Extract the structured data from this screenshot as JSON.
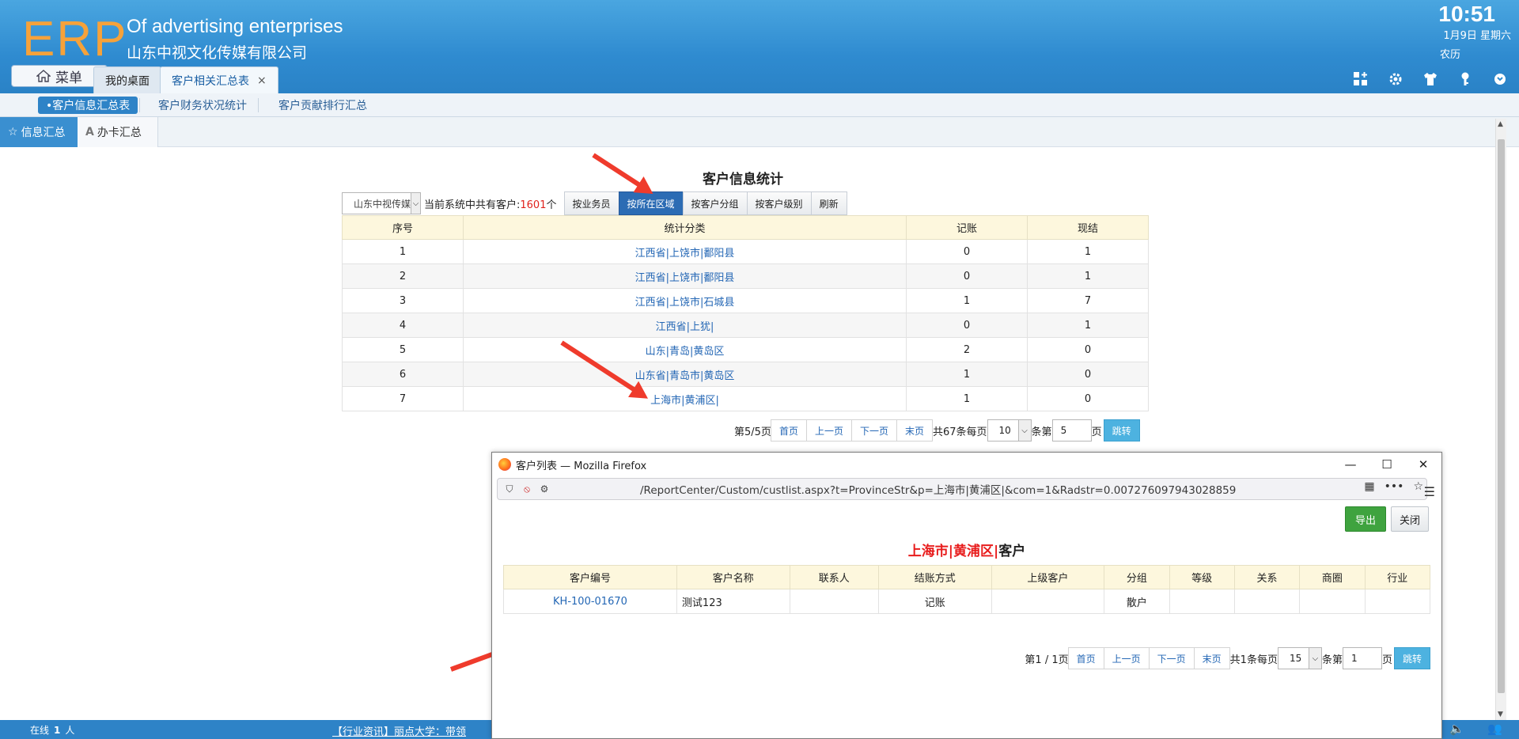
{
  "header": {
    "logo": "ERP",
    "title": "Of advertising enterprises",
    "subtitle": "山东中视文化传媒有限公司",
    "time": "10:51",
    "date": "1月9日 星期六",
    "lunar": "农历",
    "menu_label": "菜单",
    "tabs": [
      {
        "label": "我的桌面"
      },
      {
        "label": "客户相关汇总表",
        "close": "×"
      }
    ]
  },
  "subnav": {
    "items": [
      {
        "label": "•客户信息汇总表"
      },
      {
        "label": "客户财务状况统计"
      },
      {
        "label": "客户贡献排行汇总"
      }
    ]
  },
  "sidetabs": {
    "items": [
      {
        "label": "信息汇总",
        "icon": "star-icon"
      },
      {
        "label": "办卡汇总",
        "icon": "font-a-icon",
        "glyph": "A"
      }
    ]
  },
  "main": {
    "title": "客户信息统计",
    "company_select": "山东中视传媒",
    "count_prefix": "当前系统中共有客户:",
    "count_value": "1601",
    "count_suffix": "个",
    "buttons": [
      {
        "label": "按业务员"
      },
      {
        "label": "按所在区域"
      },
      {
        "label": "按客户分组"
      },
      {
        "label": "按客户级别"
      },
      {
        "label": "刷新"
      }
    ],
    "columns": [
      "序号",
      "统计分类",
      "记账",
      "现结"
    ],
    "rows": [
      {
        "no": "1",
        "category": "江西省|上饶市|鄱阳县",
        "credit": "0",
        "cash": "1"
      },
      {
        "no": "2",
        "category": "江西省|上饶市|鄱阳县",
        "credit": "0",
        "cash": "1"
      },
      {
        "no": "3",
        "category": "江西省|上饶市|石城县",
        "credit": "1",
        "cash": "7"
      },
      {
        "no": "4",
        "category": "江西省|上犹|",
        "credit": "0",
        "cash": "1"
      },
      {
        "no": "5",
        "category": "山东|青岛|黄岛区",
        "credit": "2",
        "cash": "0"
      },
      {
        "no": "6",
        "category": "山东省|青岛市|黄岛区",
        "credit": "1",
        "cash": "0"
      },
      {
        "no": "7",
        "category": "上海市|黄浦区|",
        "credit": "1",
        "cash": "0"
      }
    ],
    "pager": {
      "page_info": "第5/5页",
      "first": "首页",
      "prev": "上一页",
      "next": "下一页",
      "last": "末页",
      "total_text": "共67条每页",
      "page_size": "10",
      "goto_prefix": "条第",
      "goto_value": "5",
      "goto_suffix": "页",
      "go": "跳转"
    }
  },
  "popup": {
    "window_title": "客户列表 — Mozilla Firefox",
    "url": "/ReportCenter/Custom/custlist.aspx?t=ProvinceStr&p=上海市|黄浦区|&com=1&Radstr=0.007276097943028859",
    "export": "导出",
    "close": "关闭",
    "title_red": "上海市|黄浦区|",
    "title_suffix": "客户",
    "columns": [
      "客户编号",
      "客户名称",
      "联系人",
      "结账方式",
      "上级客户",
      "分组",
      "等级",
      "关系",
      "商圈",
      "行业"
    ],
    "rows": [
      {
        "code": "KH-100-01670",
        "name": "测试123",
        "contact": "",
        "pay": "记账",
        "parent": "",
        "group": "散户",
        "level": "",
        "relation": "",
        "area": "",
        "industry": ""
      }
    ],
    "pager": {
      "page_info": "第1 / 1页",
      "first": "首页",
      "prev": "上一页",
      "next": "下一页",
      "last": "末页",
      "total_text": "共1条每页",
      "page_size": "15",
      "goto_prefix": "条第",
      "goto_value": "1",
      "goto_suffix": "页",
      "go": "跳转"
    }
  },
  "status": {
    "online_label": "在线",
    "online_count": "1",
    "online_unit": "人",
    "news": "【行业资讯】丽点大学：带领"
  },
  "colors": {
    "header_blue": "#2f8bd0",
    "logo_orange": "#f6a23a",
    "active_button": "#2c6cb4",
    "link_blue": "#2467b5",
    "count_red": "#e0221c",
    "export_green": "#3fa33f",
    "go_button": "#4db2e0",
    "annotation_arrow": "#ef3b2c"
  }
}
